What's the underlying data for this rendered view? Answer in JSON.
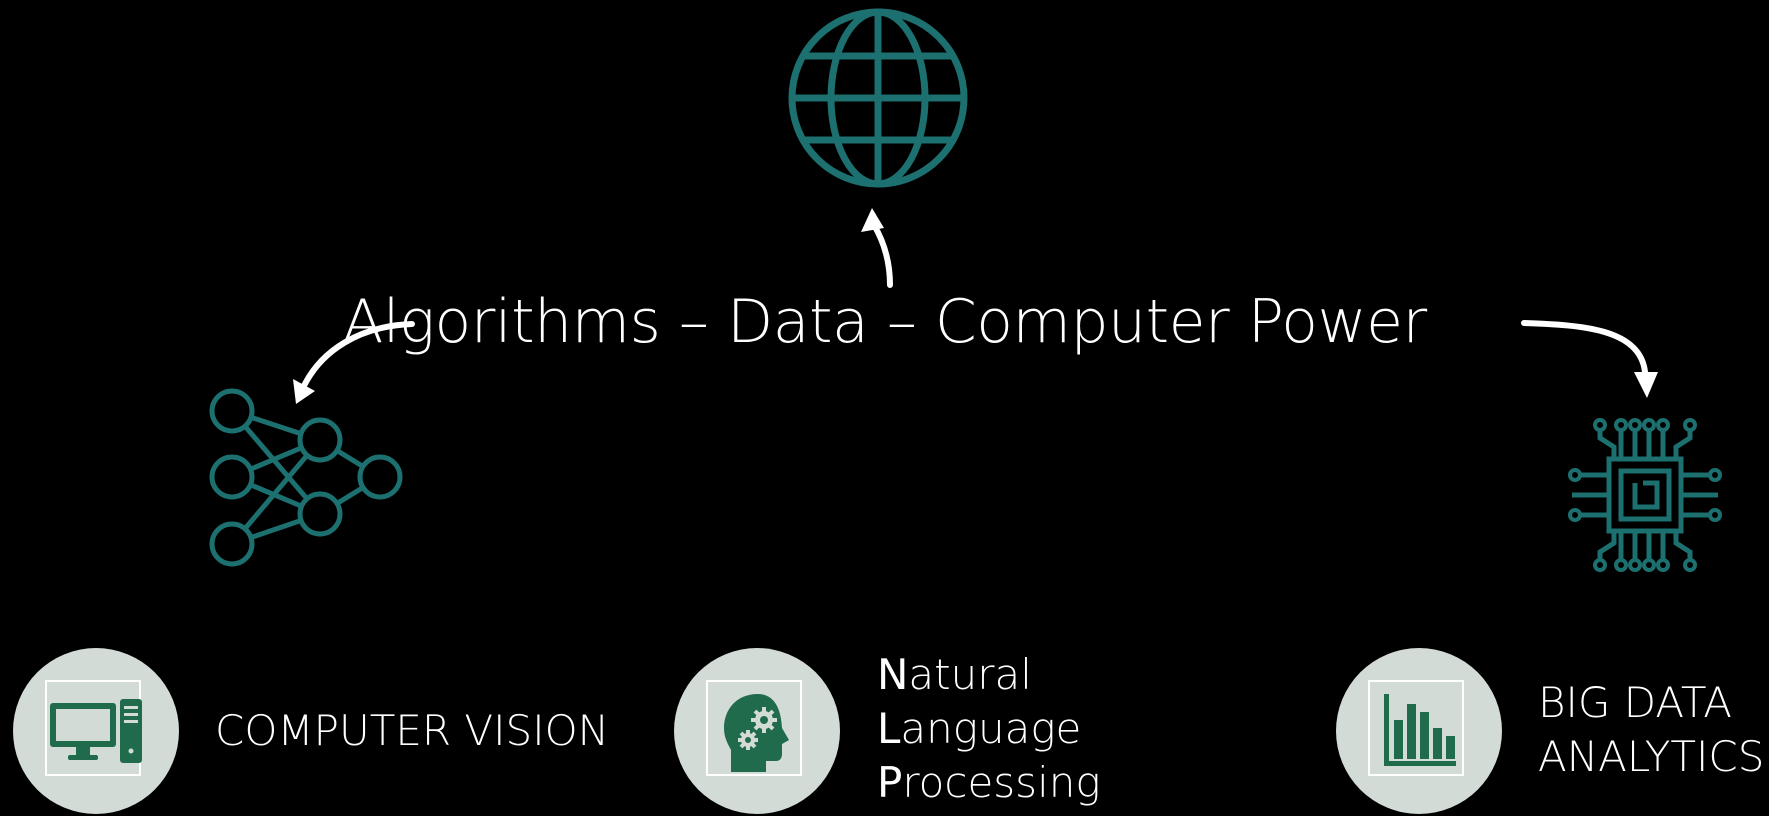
{
  "headline": {
    "text": "Algorithms – Data – Computer Power"
  },
  "colors": {
    "background": "#000000",
    "teal_icon": "#1d7070",
    "green_icon": "#1f6b4c",
    "circle_fill": "#d2dbd6",
    "text": "#ffffff"
  },
  "top_icons": [
    {
      "name": "globe-icon"
    },
    {
      "name": "neural-network-icon"
    },
    {
      "name": "circuit-chip-icon"
    }
  ],
  "applications": {
    "computer_vision": {
      "icon": "desktop-computer-icon",
      "label": "COMPUTER VISION"
    },
    "nlp": {
      "icon": "head-gears-icon",
      "lines": [
        {
          "initial": "N",
          "rest": "atural"
        },
        {
          "initial": "L",
          "rest": "anguage"
        },
        {
          "initial": "P",
          "rest": "rocessing"
        }
      ]
    },
    "big_data": {
      "icon": "bar-chart-icon",
      "lines": [
        "BIG DATA",
        "ANALYTICS"
      ]
    }
  }
}
